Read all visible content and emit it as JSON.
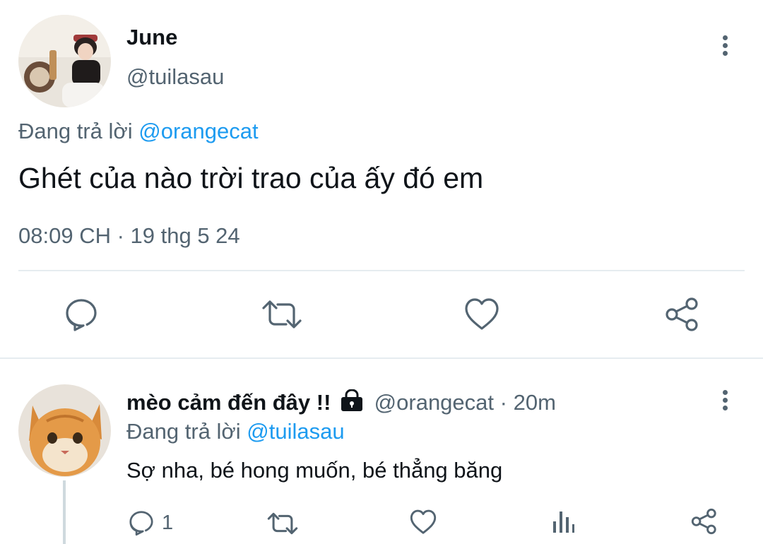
{
  "main_tweet": {
    "author_name": "June",
    "author_handle": "@tuilasau",
    "reply_prefix": "Đang trả lời",
    "reply_to": "@orangecat",
    "text": "Ghét của nào trời trao của ấy đó em",
    "timestamp": "08:09 CH · 19 thg 5 24",
    "actions": [
      "reply-icon",
      "retweet-icon",
      "like-icon",
      "share-icon"
    ]
  },
  "reply_tweet": {
    "author_name": "mèo cảm đến đây !!",
    "author_handle": "@orangecat",
    "time_sep": "·",
    "age": "20m",
    "reply_prefix": "Đang trả lời",
    "reply_to": "@tuilasau",
    "text": "Sợ nha, bé hong muốn, bé thẳng băng",
    "reply_count": "1",
    "actions": [
      "reply-icon",
      "retweet-icon",
      "like-icon",
      "analytics-icon",
      "share-icon"
    ]
  },
  "colors": {
    "text": "#0f1419",
    "muted": "#536471",
    "link": "#1d9bf0",
    "divider": "#e6ecf0"
  }
}
